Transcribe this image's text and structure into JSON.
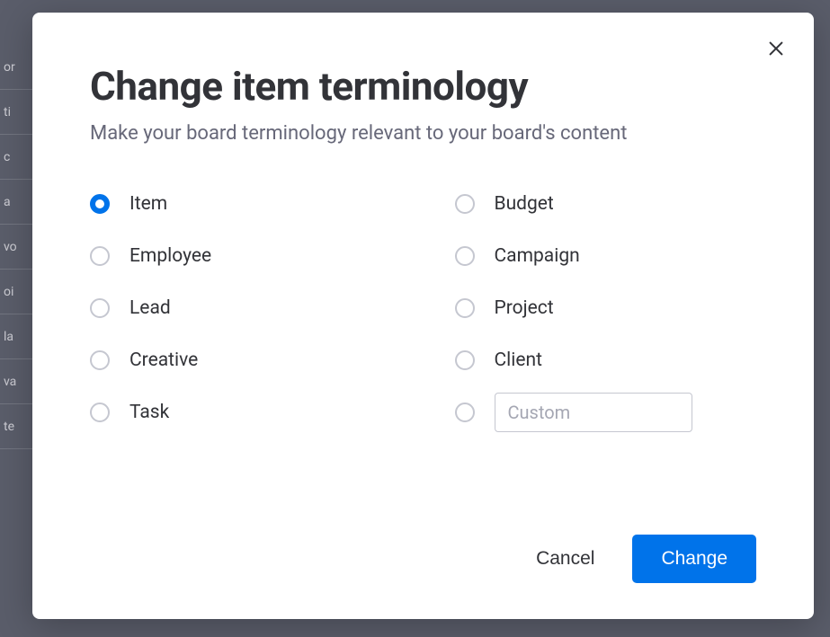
{
  "modal": {
    "title": "Change item terminology",
    "subtitle": "Make your board terminology relevant to your board's content",
    "options_col1": [
      {
        "label": "Item",
        "selected": true
      },
      {
        "label": "Employee",
        "selected": false
      },
      {
        "label": "Lead",
        "selected": false
      },
      {
        "label": "Creative",
        "selected": false
      },
      {
        "label": "Task",
        "selected": false
      }
    ],
    "options_col2": [
      {
        "label": "Budget",
        "selected": false
      },
      {
        "label": "Campaign",
        "selected": false
      },
      {
        "label": "Project",
        "selected": false
      },
      {
        "label": "Client",
        "selected": false
      }
    ],
    "custom_placeholder": "Custom",
    "custom_value": "",
    "cancel_label": "Cancel",
    "submit_label": "Change"
  },
  "background_rows": [
    "or",
    " ti",
    " c",
    " a",
    "vo",
    "oi",
    "la",
    "va",
    "te"
  ]
}
